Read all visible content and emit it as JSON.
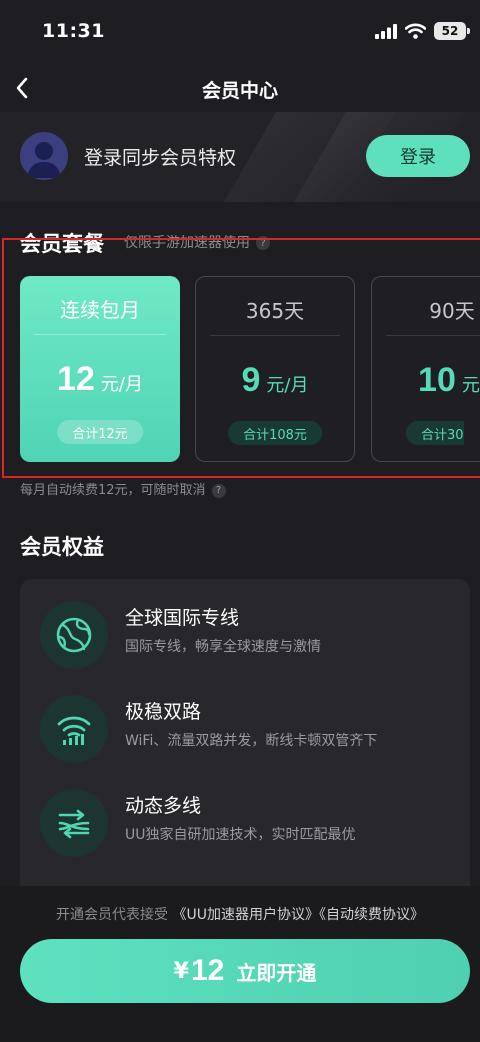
{
  "status_bar": {
    "time": "11:31",
    "battery": "52"
  },
  "nav": {
    "title": "会员中心",
    "back_icon": "chevron-left-icon"
  },
  "login": {
    "text": "登录同步会员特权",
    "button": "登录"
  },
  "plans_section": {
    "title": "会员套餐",
    "note": "仅限手游加速器使用",
    "help": "?",
    "plans": [
      {
        "name": "连续包月",
        "price": "12",
        "unit": "元/月",
        "total": "合计12元",
        "selected": true
      },
      {
        "name": "365天",
        "price": "9",
        "unit": "元/月",
        "total": "合计108元",
        "selected": false
      },
      {
        "name": "90天",
        "price": "10",
        "unit": "元/",
        "total": "合计30",
        "selected": false
      }
    ],
    "renew_note": "每月自动续费12元，可随时取消"
  },
  "benefits_section": {
    "title": "会员权益",
    "items": [
      {
        "icon": "globe-icon",
        "title": "全球国际专线",
        "desc": "国际专线，畅享全球速度与激情"
      },
      {
        "icon": "wifi-dual-icon",
        "title": "极稳双路",
        "desc": "WiFi、流量双路并发，断线卡顿双管齐下"
      },
      {
        "icon": "multi-line-arrows-icon",
        "title": "动态多线",
        "desc": "UU独家自研加速技术，实时匹配最优"
      }
    ]
  },
  "bottom": {
    "agreement_prefix": "开通会员代表接受",
    "agreement_link1": "《UU加速器用户协议》",
    "agreement_link2": "《自动续费协议》",
    "cta_symbol": "¥",
    "cta_price": "12",
    "cta_label": "立即开通"
  },
  "colors": {
    "accent": "#5fe0bd",
    "background": "#1e1e22",
    "highlight_frame": "#d6282b"
  }
}
